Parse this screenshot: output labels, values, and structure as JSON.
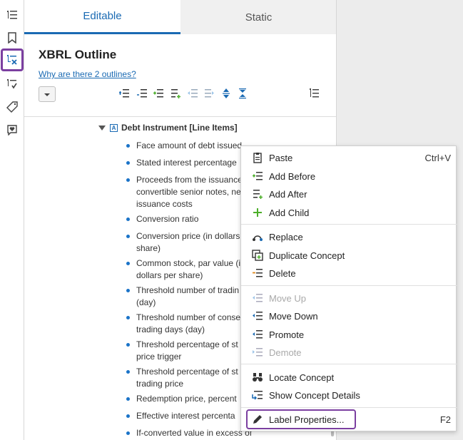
{
  "rail": {
    "icons": [
      "outline-list-icon",
      "bookmark-icon",
      "outline-x-icon",
      "outline-check-icon",
      "tag-icon",
      "comment-heart-icon"
    ]
  },
  "tabs": {
    "editable": "Editable",
    "static": "Static"
  },
  "outline": {
    "title": "XBRL Outline",
    "help_link": "Why are there 2 outlines?"
  },
  "tree": {
    "root": "Debt Instrument [Line Items]",
    "items": [
      "Face amount of debt issued",
      "Stated interest percentage",
      "Proceeds from the issuance\nconvertible senior notes, ne\nissuance costs",
      "Conversion ratio",
      "Conversion price (in dollars\nshare)",
      "Common stock, par value (i\ndollars per share)",
      "Threshold number of tradin\n(day)",
      "Threshold number of conse\ntrading days (day)",
      "Threshold percentage of st\nprice trigger",
      "Threshold percentage of st\ntrading price",
      "Redemption price, percent",
      "Effective interest percenta",
      "If-converted value in excess of"
    ]
  },
  "menu": {
    "paste": "Paste",
    "paste_shortcut": "Ctrl+V",
    "add_before": "Add Before",
    "add_after": "Add After",
    "add_child": "Add Child",
    "replace": "Replace",
    "duplicate": "Duplicate Concept",
    "delete": "Delete",
    "move_up": "Move Up",
    "move_down": "Move Down",
    "promote": "Promote",
    "demote": "Demote",
    "locate": "Locate Concept",
    "show_details": "Show Concept Details",
    "label_properties": "Label Properties...",
    "label_properties_shortcut": "F2"
  },
  "colors": {
    "accent": "#1a6ab3",
    "highlight": "#7b3fa0",
    "green": "#4caf2a",
    "orange": "#e08a1e"
  }
}
